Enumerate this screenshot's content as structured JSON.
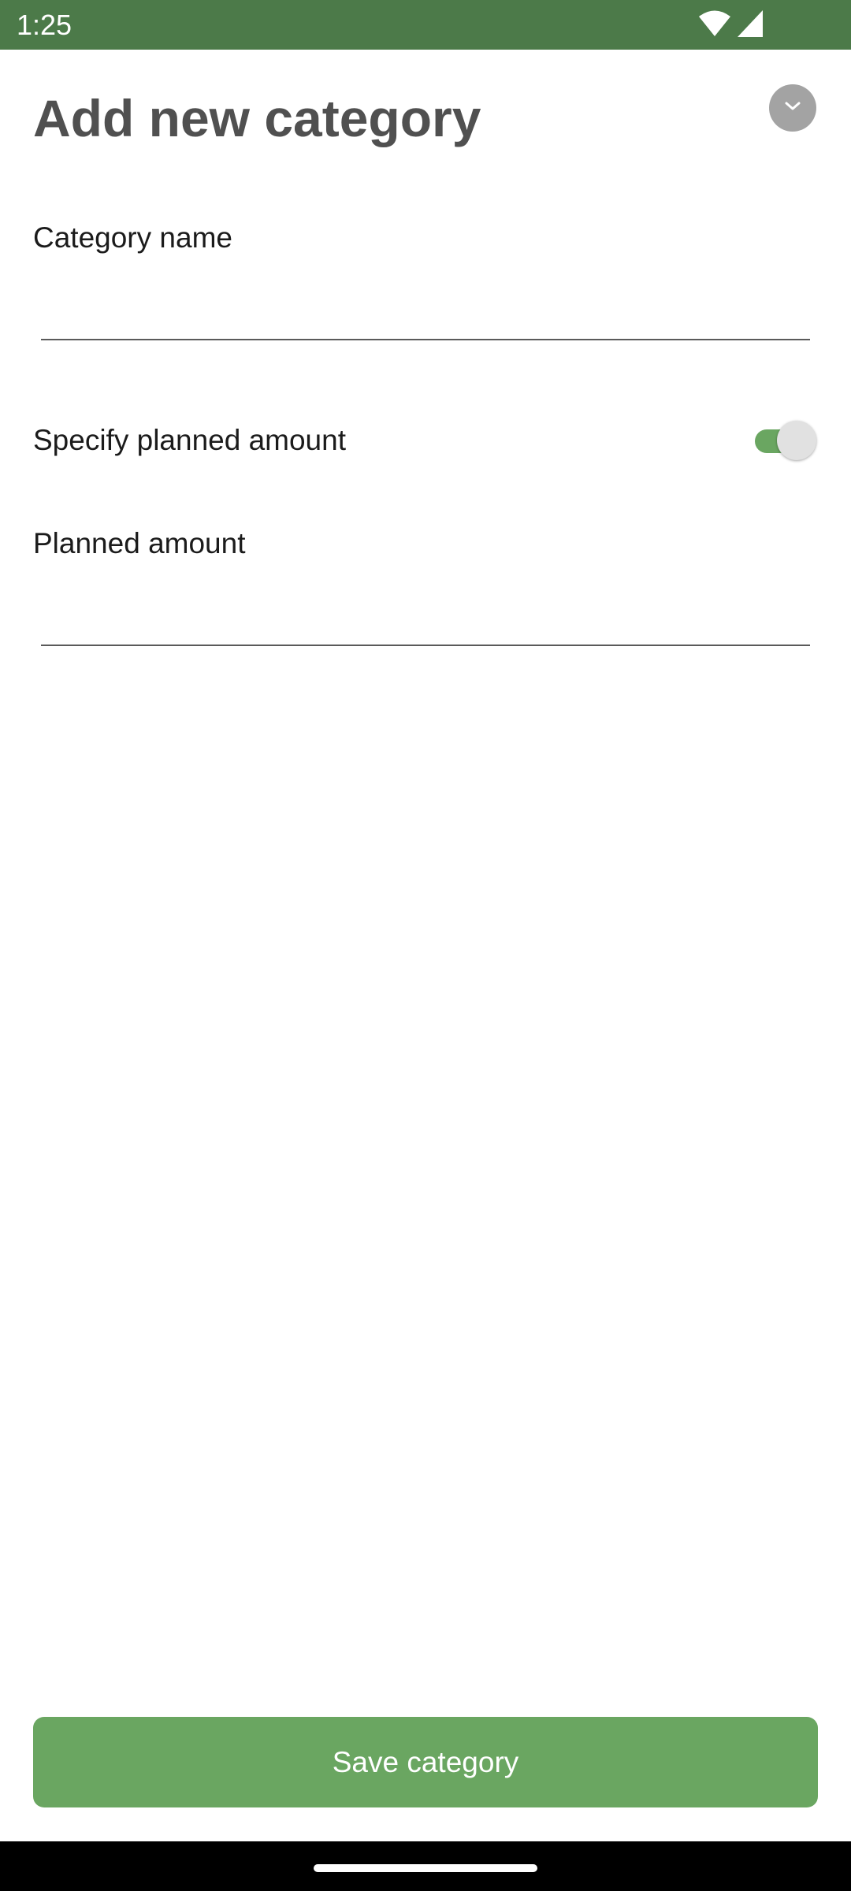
{
  "status_bar": {
    "time": "1:25",
    "background_color": "#4c7a49",
    "icons": [
      "wifi-icon",
      "cell-signal-icon"
    ]
  },
  "header": {
    "title": "Add new category",
    "collapse_icon": "chevron-down-icon"
  },
  "form": {
    "category_name": {
      "label": "Category name",
      "value": "",
      "placeholder": ""
    },
    "specify_planned_amount": {
      "label": "Specify planned amount",
      "checked": true
    },
    "planned_amount": {
      "label": "Planned amount",
      "value": "",
      "placeholder": ""
    }
  },
  "actions": {
    "save_label": "Save category"
  },
  "colors": {
    "accent": "#6aa661",
    "status_bar": "#4c7a49",
    "title_text": "#505050"
  }
}
